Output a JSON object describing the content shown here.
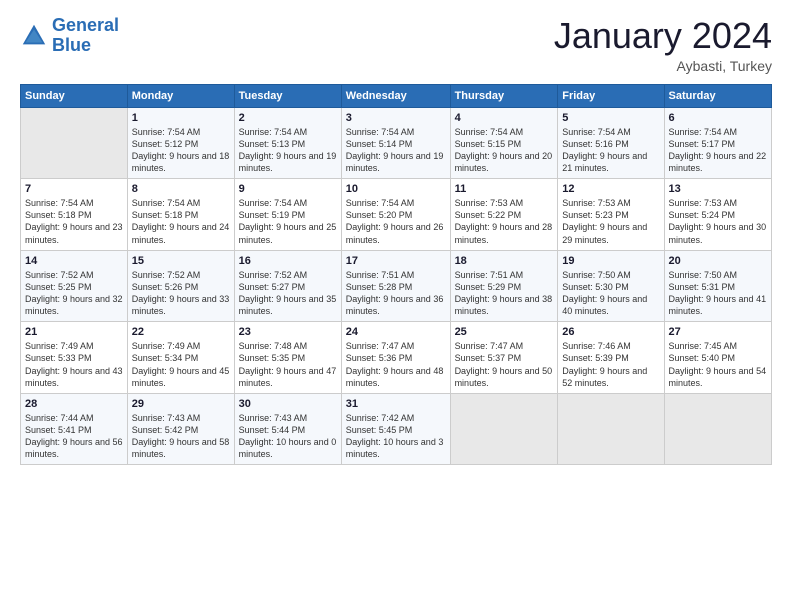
{
  "logo": {
    "line1": "General",
    "line2": "Blue"
  },
  "title": "January 2024",
  "subtitle": "Aybasti, Turkey",
  "days_header": [
    "Sunday",
    "Monday",
    "Tuesday",
    "Wednesday",
    "Thursday",
    "Friday",
    "Saturday"
  ],
  "weeks": [
    [
      {
        "num": "",
        "sunrise": "",
        "sunset": "",
        "daylight": ""
      },
      {
        "num": "1",
        "sunrise": "Sunrise: 7:54 AM",
        "sunset": "Sunset: 5:12 PM",
        "daylight": "Daylight: 9 hours and 18 minutes."
      },
      {
        "num": "2",
        "sunrise": "Sunrise: 7:54 AM",
        "sunset": "Sunset: 5:13 PM",
        "daylight": "Daylight: 9 hours and 19 minutes."
      },
      {
        "num": "3",
        "sunrise": "Sunrise: 7:54 AM",
        "sunset": "Sunset: 5:14 PM",
        "daylight": "Daylight: 9 hours and 19 minutes."
      },
      {
        "num": "4",
        "sunrise": "Sunrise: 7:54 AM",
        "sunset": "Sunset: 5:15 PM",
        "daylight": "Daylight: 9 hours and 20 minutes."
      },
      {
        "num": "5",
        "sunrise": "Sunrise: 7:54 AM",
        "sunset": "Sunset: 5:16 PM",
        "daylight": "Daylight: 9 hours and 21 minutes."
      },
      {
        "num": "6",
        "sunrise": "Sunrise: 7:54 AM",
        "sunset": "Sunset: 5:17 PM",
        "daylight": "Daylight: 9 hours and 22 minutes."
      }
    ],
    [
      {
        "num": "7",
        "sunrise": "Sunrise: 7:54 AM",
        "sunset": "Sunset: 5:18 PM",
        "daylight": "Daylight: 9 hours and 23 minutes."
      },
      {
        "num": "8",
        "sunrise": "Sunrise: 7:54 AM",
        "sunset": "Sunset: 5:18 PM",
        "daylight": "Daylight: 9 hours and 24 minutes."
      },
      {
        "num": "9",
        "sunrise": "Sunrise: 7:54 AM",
        "sunset": "Sunset: 5:19 PM",
        "daylight": "Daylight: 9 hours and 25 minutes."
      },
      {
        "num": "10",
        "sunrise": "Sunrise: 7:54 AM",
        "sunset": "Sunset: 5:20 PM",
        "daylight": "Daylight: 9 hours and 26 minutes."
      },
      {
        "num": "11",
        "sunrise": "Sunrise: 7:53 AM",
        "sunset": "Sunset: 5:22 PM",
        "daylight": "Daylight: 9 hours and 28 minutes."
      },
      {
        "num": "12",
        "sunrise": "Sunrise: 7:53 AM",
        "sunset": "Sunset: 5:23 PM",
        "daylight": "Daylight: 9 hours and 29 minutes."
      },
      {
        "num": "13",
        "sunrise": "Sunrise: 7:53 AM",
        "sunset": "Sunset: 5:24 PM",
        "daylight": "Daylight: 9 hours and 30 minutes."
      }
    ],
    [
      {
        "num": "14",
        "sunrise": "Sunrise: 7:52 AM",
        "sunset": "Sunset: 5:25 PM",
        "daylight": "Daylight: 9 hours and 32 minutes."
      },
      {
        "num": "15",
        "sunrise": "Sunrise: 7:52 AM",
        "sunset": "Sunset: 5:26 PM",
        "daylight": "Daylight: 9 hours and 33 minutes."
      },
      {
        "num": "16",
        "sunrise": "Sunrise: 7:52 AM",
        "sunset": "Sunset: 5:27 PM",
        "daylight": "Daylight: 9 hours and 35 minutes."
      },
      {
        "num": "17",
        "sunrise": "Sunrise: 7:51 AM",
        "sunset": "Sunset: 5:28 PM",
        "daylight": "Daylight: 9 hours and 36 minutes."
      },
      {
        "num": "18",
        "sunrise": "Sunrise: 7:51 AM",
        "sunset": "Sunset: 5:29 PM",
        "daylight": "Daylight: 9 hours and 38 minutes."
      },
      {
        "num": "19",
        "sunrise": "Sunrise: 7:50 AM",
        "sunset": "Sunset: 5:30 PM",
        "daylight": "Daylight: 9 hours and 40 minutes."
      },
      {
        "num": "20",
        "sunrise": "Sunrise: 7:50 AM",
        "sunset": "Sunset: 5:31 PM",
        "daylight": "Daylight: 9 hours and 41 minutes."
      }
    ],
    [
      {
        "num": "21",
        "sunrise": "Sunrise: 7:49 AM",
        "sunset": "Sunset: 5:33 PM",
        "daylight": "Daylight: 9 hours and 43 minutes."
      },
      {
        "num": "22",
        "sunrise": "Sunrise: 7:49 AM",
        "sunset": "Sunset: 5:34 PM",
        "daylight": "Daylight: 9 hours and 45 minutes."
      },
      {
        "num": "23",
        "sunrise": "Sunrise: 7:48 AM",
        "sunset": "Sunset: 5:35 PM",
        "daylight": "Daylight: 9 hours and 47 minutes."
      },
      {
        "num": "24",
        "sunrise": "Sunrise: 7:47 AM",
        "sunset": "Sunset: 5:36 PM",
        "daylight": "Daylight: 9 hours and 48 minutes."
      },
      {
        "num": "25",
        "sunrise": "Sunrise: 7:47 AM",
        "sunset": "Sunset: 5:37 PM",
        "daylight": "Daylight: 9 hours and 50 minutes."
      },
      {
        "num": "26",
        "sunrise": "Sunrise: 7:46 AM",
        "sunset": "Sunset: 5:39 PM",
        "daylight": "Daylight: 9 hours and 52 minutes."
      },
      {
        "num": "27",
        "sunrise": "Sunrise: 7:45 AM",
        "sunset": "Sunset: 5:40 PM",
        "daylight": "Daylight: 9 hours and 54 minutes."
      }
    ],
    [
      {
        "num": "28",
        "sunrise": "Sunrise: 7:44 AM",
        "sunset": "Sunset: 5:41 PM",
        "daylight": "Daylight: 9 hours and 56 minutes."
      },
      {
        "num": "29",
        "sunrise": "Sunrise: 7:43 AM",
        "sunset": "Sunset: 5:42 PM",
        "daylight": "Daylight: 9 hours and 58 minutes."
      },
      {
        "num": "30",
        "sunrise": "Sunrise: 7:43 AM",
        "sunset": "Sunset: 5:44 PM",
        "daylight": "Daylight: 10 hours and 0 minutes."
      },
      {
        "num": "31",
        "sunrise": "Sunrise: 7:42 AM",
        "sunset": "Sunset: 5:45 PM",
        "daylight": "Daylight: 10 hours and 3 minutes."
      },
      {
        "num": "",
        "sunrise": "",
        "sunset": "",
        "daylight": ""
      },
      {
        "num": "",
        "sunrise": "",
        "sunset": "",
        "daylight": ""
      },
      {
        "num": "",
        "sunrise": "",
        "sunset": "",
        "daylight": ""
      }
    ]
  ]
}
